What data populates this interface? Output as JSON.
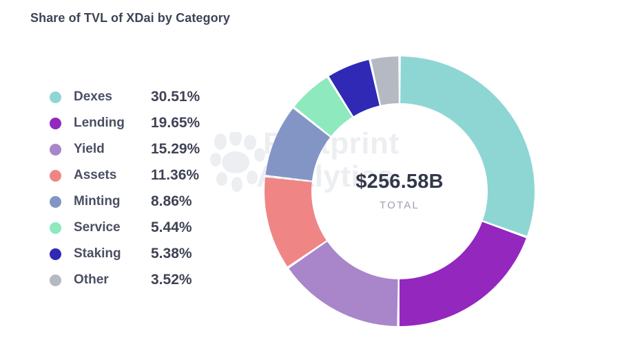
{
  "header": {
    "title": "Share of TVL of XDai by Category"
  },
  "watermark": {
    "line1": "Footprint",
    "line2": "Analytics",
    "logo": "paw-footprint-logo"
  },
  "donut": {
    "center_value": "$256.58B",
    "center_label": "TOTAL"
  },
  "legend": {
    "items": [
      {
        "label": "Dexes",
        "value": "30.51%",
        "color": "#8ed6d4"
      },
      {
        "label": "Lending",
        "value": "19.65%",
        "color": "#9327be"
      },
      {
        "label": "Yield",
        "value": "15.29%",
        "color": "#a886c9"
      },
      {
        "label": "Assets",
        "value": "11.36%",
        "color": "#ef8585"
      },
      {
        "label": "Minting",
        "value": "8.86%",
        "color": "#8295c5"
      },
      {
        "label": "Service",
        "value": "5.44%",
        "color": "#8ee9bf"
      },
      {
        "label": "Staking",
        "value": "5.38%",
        "color": "#3029b5"
      },
      {
        "label": "Other",
        "value": "3.52%",
        "color": "#b5b9c1"
      }
    ]
  },
  "chart_data": {
    "type": "pie",
    "variant": "donut",
    "title": "Share of TVL of XDai by Category",
    "center_value": "$256.58B",
    "center_label": "TOTAL",
    "unit": "percent",
    "total_label": "$256.58B",
    "start_angle_deg": 0,
    "direction": "clockwise",
    "categories": [
      "Dexes",
      "Lending",
      "Yield",
      "Assets",
      "Minting",
      "Service",
      "Staking",
      "Other"
    ],
    "values": [
      30.51,
      19.65,
      15.29,
      11.36,
      8.86,
      5.44,
      5.38,
      3.52
    ],
    "colors": [
      "#8ed6d4",
      "#9327be",
      "#a886c9",
      "#ef8585",
      "#8295c5",
      "#8ee9bf",
      "#3029b5",
      "#b5b9c1"
    ],
    "legend_position": "left",
    "grid": false,
    "xlabel": "",
    "ylabel": ""
  }
}
